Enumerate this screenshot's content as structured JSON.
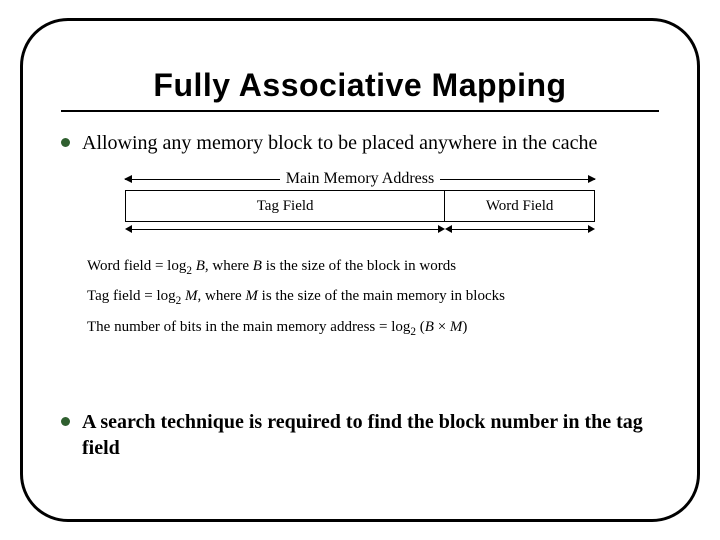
{
  "title": "Fully Associative Mapping",
  "bullets": [
    "Allowing any memory block to be placed anywhere in the cache",
    "A search technique is required to find the block number in the tag field"
  ],
  "diagram": {
    "mainLabel": "Main Memory Address",
    "tagLabel": "Tag Field",
    "wordLabel": "Word Field"
  },
  "formulas": {
    "line1_pre": "Word field = log",
    "line1_sub": "2",
    "line1_var": " B",
    "line1_post": ", where ",
    "line1_var2": "B",
    "line1_end": " is the size of the block in words",
    "line2_pre": "Tag field = log",
    "line2_sub": "2",
    "line2_var": " M",
    "line2_post": ", where ",
    "line2_var2": "M",
    "line2_end": " is the size of the main memory in blocks",
    "line3_pre": "The number of bits in the main memory address = log",
    "line3_sub": "2",
    "line3_open": " (",
    "line3_v1": "B",
    "line3_times": " × ",
    "line3_v2": "M",
    "line3_close": ")"
  }
}
